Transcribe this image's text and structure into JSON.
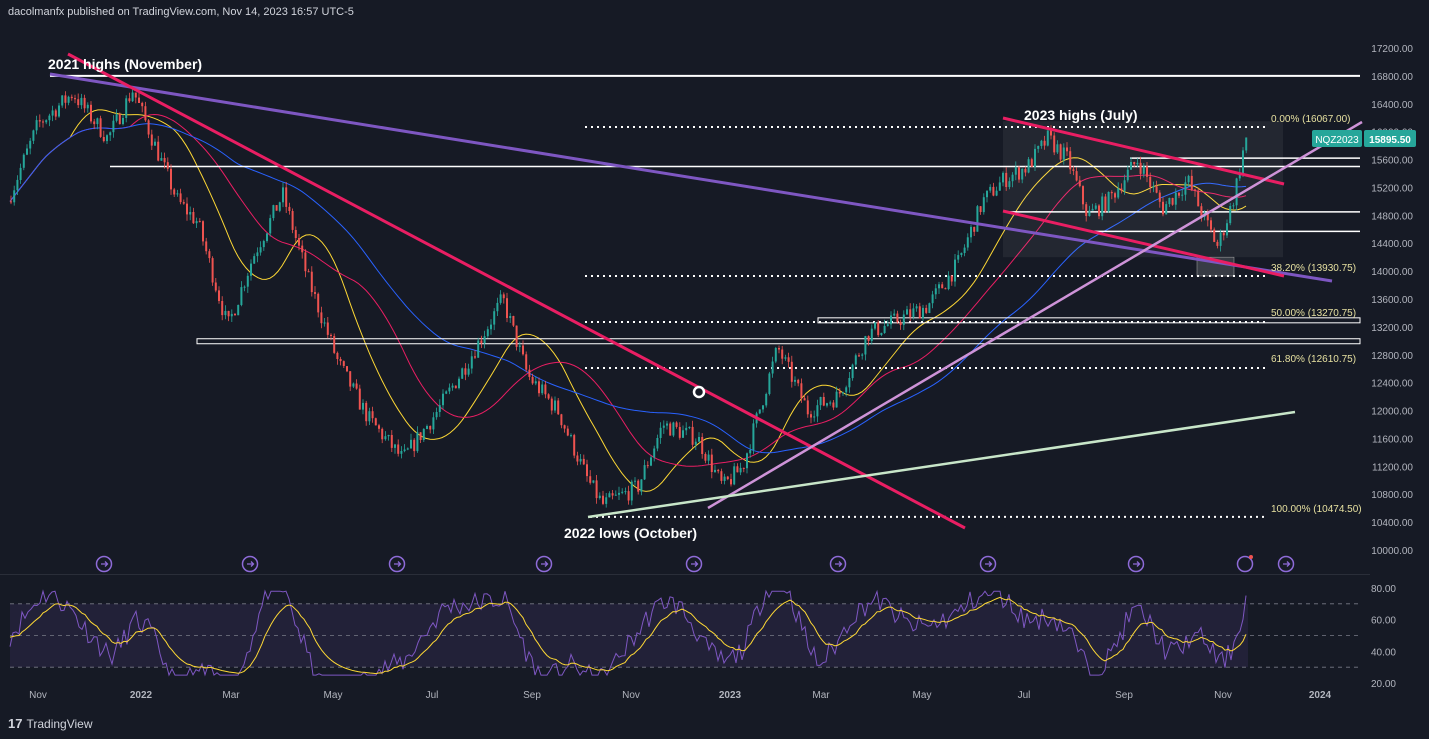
{
  "header": {
    "text": "dacolmanfx published on TradingView.com, Nov 14, 2023 16:57 UTC-5"
  },
  "footer": {
    "logo_mark": "17",
    "brand": "TradingView"
  },
  "colors": {
    "bg": "#161a25",
    "up": "#26a69a",
    "down": "#ef5350",
    "trend_pink": "#e91e63",
    "trend_purple": "#7e57c2",
    "trend_lilac": "#ce93d8",
    "trend_green": "#c8e6c9",
    "ma_yellow": "#fdd835",
    "ma_red": "#e91e63",
    "ma_blue": "#2962ff",
    "rsi": "#7e57c2",
    "rsi_signal": "#fdd835",
    "price_badge": "#26a69a"
  },
  "chart_data": {
    "type": "candlestick",
    "symbol": "NQZ2023",
    "last_price": 15895.5,
    "last_price_label": "15895.50",
    "y_axis": [
      "17200.00",
      "16800.00",
      "16400.00",
      "16000.00",
      "15600.00",
      "15200.00",
      "14800.00",
      "14400.00",
      "14000.00",
      "13600.00",
      "13200.00",
      "12800.00",
      "12400.00",
      "12000.00",
      "11600.00",
      "11200.00",
      "10800.00",
      "10400.00",
      "10000.00"
    ],
    "x_axis": [
      "Nov",
      "2022",
      "Mar",
      "May",
      "Jul",
      "Sep",
      "Nov",
      "2023",
      "Mar",
      "May",
      "Jul",
      "Sep",
      "Nov",
      "2024"
    ],
    "annotations": [
      "2021 highs (November)",
      "2023 highs (July)",
      "2022 lows (October)"
    ],
    "fibonacci": [
      {
        "label": "0.00% (16067.00)",
        "value": 16067.0
      },
      {
        "label": "38.20% (13930.75)",
        "value": 13930.75
      },
      {
        "label": "50.00% (13270.75)",
        "value": 13270.75
      },
      {
        "label": "61.80% (12610.75)",
        "value": 12610.75
      },
      {
        "label": "100.00% (10474.50)",
        "value": 10474.5
      }
    ],
    "horizontal_levels": [
      16800,
      15500,
      15600,
      14850,
      14570,
      13000
    ],
    "series": [
      {
        "name": "Price",
        "x": [],
        "y": []
      },
      {
        "name": "",
        "y_points": []
      }
    ],
    "rsi": {
      "axis": [
        "80.00",
        "60.00",
        "40.00",
        "20.00"
      ],
      "levels": [
        70,
        30
      ]
    }
  }
}
